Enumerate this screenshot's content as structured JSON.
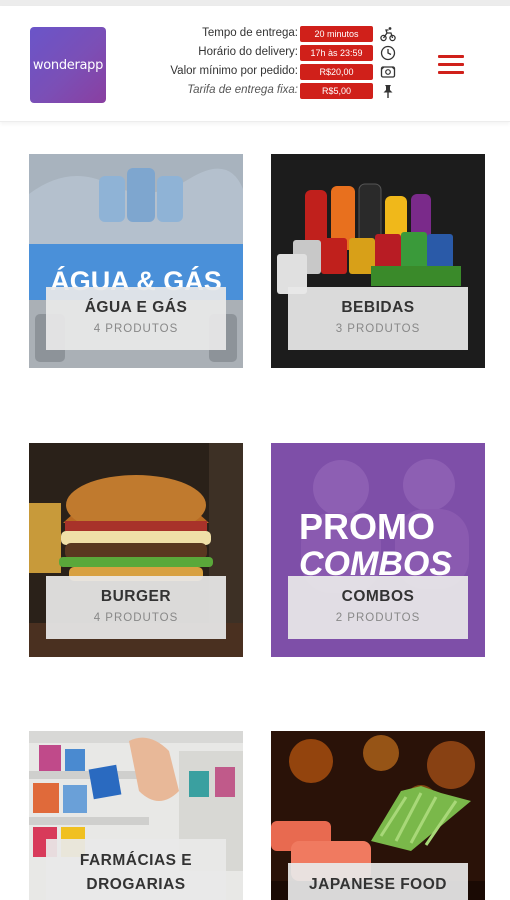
{
  "header": {
    "logo_text": "wonderapp",
    "info": [
      {
        "label": "Tempo de entrega:",
        "value": "20 minutos",
        "icon": "bike-icon"
      },
      {
        "label": "Horário do delivery:",
        "value": "17h às 23:59",
        "icon": "clock-icon"
      },
      {
        "label": "Valor mínimo por pedido:",
        "value": "R$20,00",
        "icon": "money-icon"
      },
      {
        "label": "Tarifa de entrega fixa:",
        "value": "R$5,00",
        "icon": "pin-icon"
      }
    ],
    "menu_icon": "hamburger-menu-icon"
  },
  "categories": [
    {
      "title": "ÁGUA E GÁS",
      "count": "4 PRODUTOS",
      "banner_text": "ÁGUA & GÁS"
    },
    {
      "title": "BEBIDAS",
      "count": "3 PRODUTOS"
    },
    {
      "title": "BURGER",
      "count": "4 PRODUTOS"
    },
    {
      "title": "COMBOS",
      "count": "2 PRODUTOS",
      "banner_line1": "PROMO",
      "banner_line2": "COMBOS"
    },
    {
      "title": "FARMÁCIAS E DROGARIAS",
      "title_line1": "FARMÁCIAS E",
      "title_line2": "DROGARIAS"
    },
    {
      "title": "JAPANESE FOOD"
    }
  ],
  "colors": {
    "accent_red": "#d0201a",
    "logo_purple": "#6a55c9",
    "promo_purple": "#7e4fa8"
  }
}
